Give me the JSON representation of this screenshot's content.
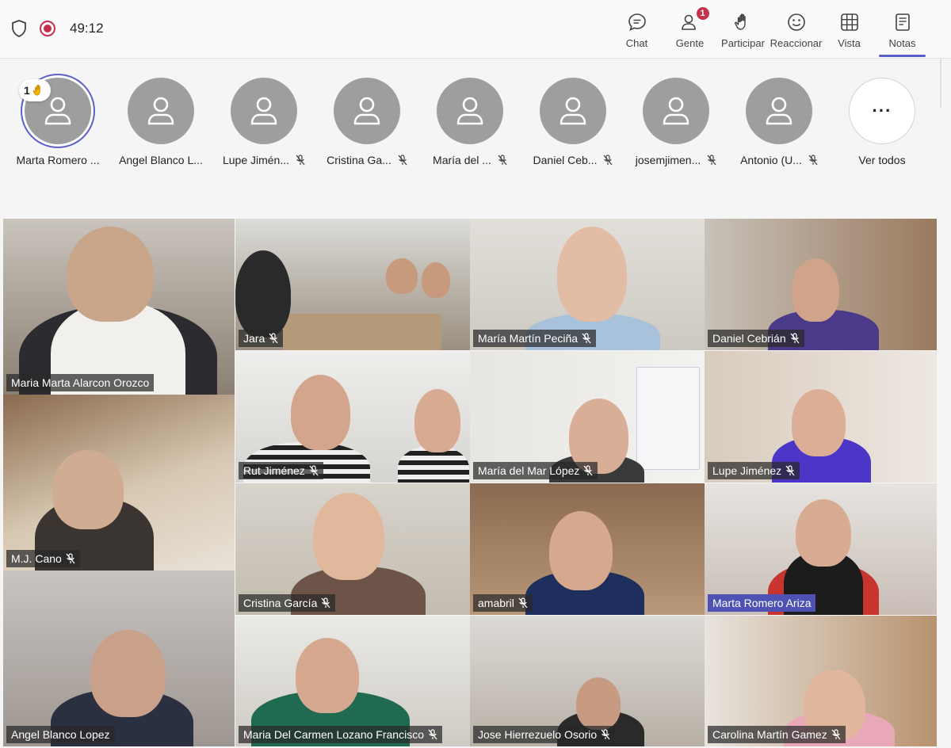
{
  "meeting": {
    "timer": "49:12"
  },
  "toolbar": {
    "chat": "Chat",
    "people": "Gente",
    "people_badge": "1",
    "raise": "Participar",
    "react": "Reaccionar",
    "view": "Vista",
    "notes": "Notas"
  },
  "attendees": [
    {
      "name": "Marta Romero ...",
      "hand": "1",
      "muted": false
    },
    {
      "name": "Angel Blanco L...",
      "muted": false
    },
    {
      "name": "Lupe Jimén...",
      "muted": true
    },
    {
      "name": "Cristina Ga...",
      "muted": true
    },
    {
      "name": "María del ...",
      "muted": true
    },
    {
      "name": "Daniel Ceb...",
      "muted": true
    },
    {
      "name": "josemjimen...",
      "muted": true
    },
    {
      "name": "Antonio (U...",
      "muted": true
    }
  ],
  "see_all": "Ver todos",
  "tiles": [
    {
      "name": "Maria Marta Alarcon Orozco"
    },
    {
      "name": "Jara"
    },
    {
      "name": "María Martín Peciña"
    },
    {
      "name": "Daniel Cebrián"
    },
    {
      "name": "Rut Jiménez"
    },
    {
      "name": "María del Mar López"
    },
    {
      "name": "Lupe Jiménez"
    },
    {
      "name": "M.J. Cano"
    },
    {
      "name": "Cristina García"
    },
    {
      "name": "amabril"
    },
    {
      "name": "Marta Romero Ariza"
    },
    {
      "name": "Angel Blanco Lopez"
    },
    {
      "name": "Maria Del Carmen Lozano Francisco"
    },
    {
      "name": "Jose Hierrezuelo Osorio"
    },
    {
      "name": "Carolina Martín Gamez"
    }
  ],
  "colors": {
    "accent": "#5b5fc7",
    "recording": "#c4314b",
    "avatar": "#9e9e9e"
  }
}
